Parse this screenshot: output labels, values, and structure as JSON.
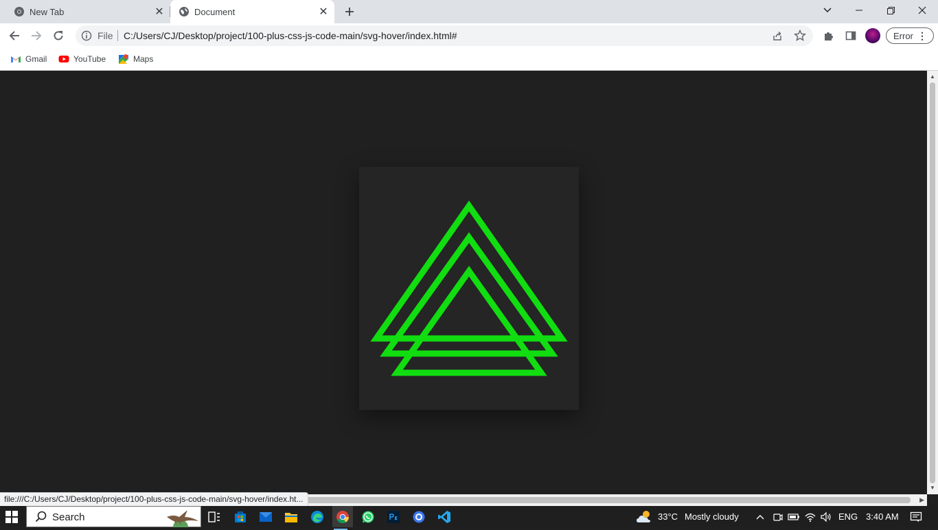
{
  "browser": {
    "tabs": [
      {
        "title": "New Tab",
        "active": false,
        "icon": "chrome-icon"
      },
      {
        "title": "Document",
        "active": true,
        "icon": "globe-icon"
      }
    ],
    "omnibox": {
      "scheme_label": "File",
      "url": "C:/Users/CJ/Desktop/project/100-plus-css-js-code-main/svg-hover/index.html#"
    },
    "profile_chip": "Error",
    "bookmarks": [
      {
        "label": "Gmail",
        "icon": "gmail-icon"
      },
      {
        "label": "YouTube",
        "icon": "youtube-icon"
      },
      {
        "label": "Maps",
        "icon": "maps-icon"
      }
    ],
    "status_url": "file:///C:/Users/CJ/Desktop/project/100-plus-css-js-code-main/svg-hover/index.ht..."
  },
  "page": {
    "background_color": "#202020",
    "card_color": "#252525",
    "triangle_stroke_color": "#11dd11",
    "triangle_count": 3
  },
  "taskbar": {
    "search_label": "Search",
    "weather": {
      "temperature": "33°C",
      "condition": "Mostly cloudy"
    },
    "language": "ENG",
    "time": "3:40 AM",
    "apps": [
      "task-view-icon",
      "store-icon",
      "mail-icon",
      "file-explorer-icon",
      "edge-icon",
      "chrome-icon",
      "whatsapp-icon",
      "photoshop-icon",
      "signal-icon",
      "vscode-icon"
    ]
  }
}
